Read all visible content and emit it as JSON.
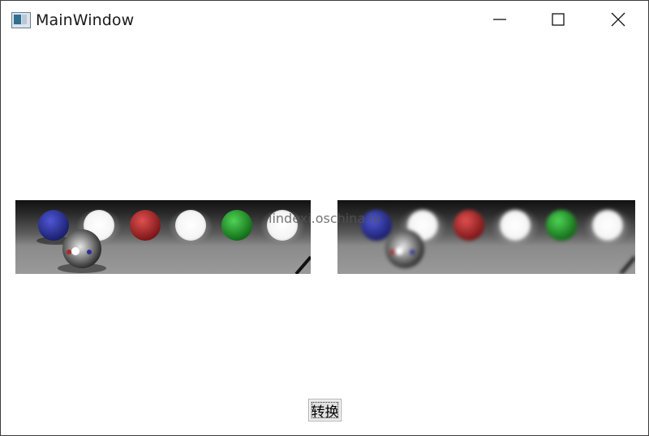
{
  "window": {
    "title": "MainWindow",
    "icon": "app-window-icon",
    "controls": {
      "minimize_icon": "minimize-icon",
      "maximize_icon": "maximize-icon",
      "close_icon": "close-icon"
    }
  },
  "images": {
    "left": {
      "description_icon": "original-image",
      "sphere_colors": [
        "#2a2f9a",
        "#f4f4f4",
        "#b8262a",
        "#f7f7f7",
        "#22a12a",
        "#f5f5f5"
      ]
    },
    "right": {
      "description_icon": "blurred-image",
      "blurred": true
    }
  },
  "watermark": "lindexi.oschina.io",
  "convert_button": {
    "label": "转换"
  }
}
